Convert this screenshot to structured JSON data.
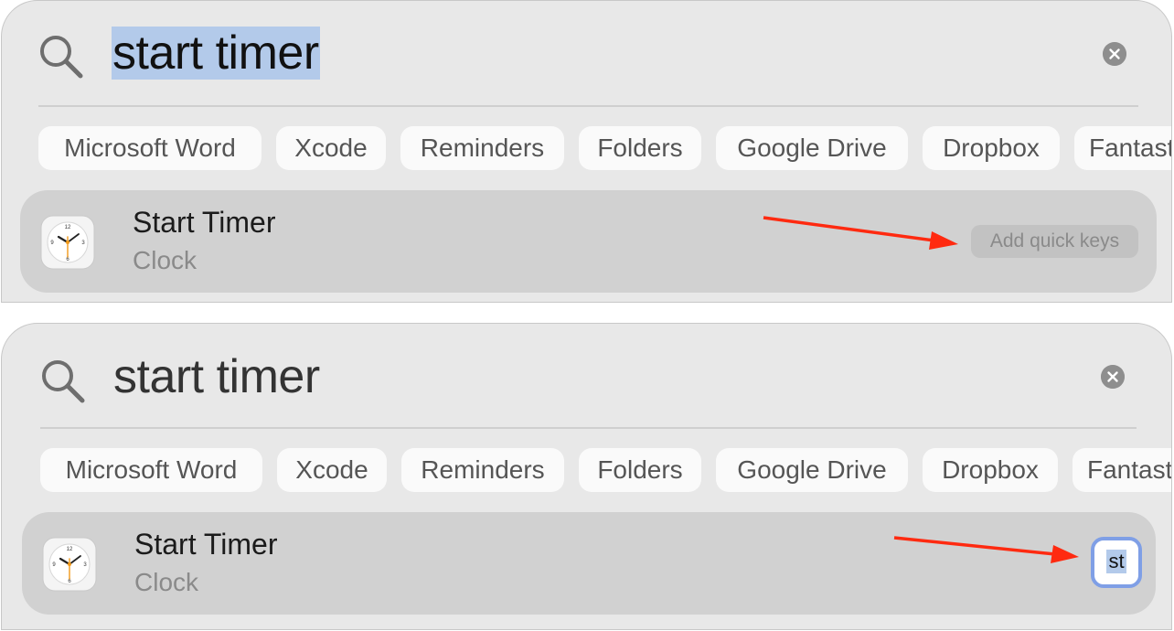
{
  "panels": [
    {
      "query": "start timer",
      "chips": [
        "Microsoft Word",
        "Xcode",
        "Reminders",
        "Folders",
        "Google Drive",
        "Dropbox",
        "Fantast"
      ],
      "result": {
        "title": "Start Timer",
        "subtitle": "Clock"
      },
      "action": {
        "label": "Add quick keys"
      }
    },
    {
      "query": "start timer",
      "chips": [
        "Microsoft Word",
        "Xcode",
        "Reminders",
        "Folders",
        "Google Drive",
        "Dropbox",
        "Fantast"
      ],
      "result": {
        "title": "Start Timer",
        "subtitle": "Clock"
      },
      "quick_key": {
        "value": "st"
      }
    }
  ],
  "colors": {
    "panel_bg": "#e8e8e8",
    "row_highlight": "#d1d1d1",
    "selection": "#b3caea",
    "arrow": "#ff2a10",
    "focus_ring": "#7f9fe6"
  },
  "icons": [
    "search-icon",
    "clear-icon",
    "clock-app-icon",
    "arrow-annotation"
  ]
}
